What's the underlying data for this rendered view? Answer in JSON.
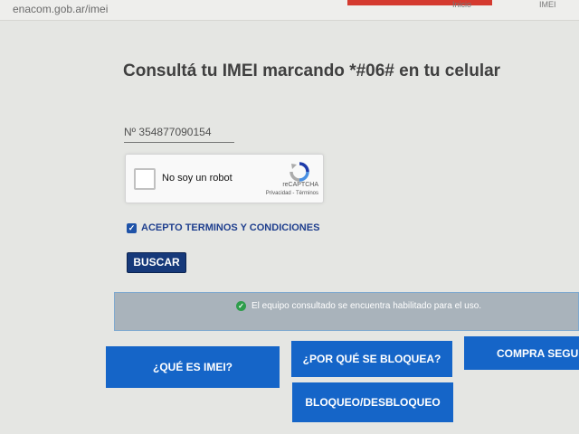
{
  "browser": {
    "url": "enacom.gob.ar/imei",
    "tabs": [
      "Inicio",
      "IMEI"
    ]
  },
  "page": {
    "title": "Consultá tu IMEI marcando *#06# en tu celular"
  },
  "imei_form": {
    "prefix": "Nº",
    "value": "354877090154",
    "recaptcha": {
      "label": "No soy un robot",
      "brand": "reCAPTCHA",
      "links": "Privacidad - Términos"
    },
    "terms_label": "ACEPTO TERMINOS Y CONDICIONES",
    "search_label": "BUSCAR"
  },
  "status": {
    "message": "El equipo consultado se encuentra habilitado para el uso."
  },
  "nav_buttons": {
    "que_es_imei": "¿QUÉ ES IMEI?",
    "por_que_bloquea": "¿POR QUÉ SE BLOQUEA?",
    "compra_segura": "COMPRA SEGURA",
    "bloqueo_desbloqueo": "BLOQUEO/DESBLOQUEO"
  },
  "colors": {
    "primary_blue": "#1565c8",
    "dark_blue": "#16397a",
    "success_green": "#2e9d4b",
    "status_gray": "#a9b3bb",
    "tab_accent": "#d43a2f"
  },
  "icons": [
    "recaptcha-logo-icon",
    "checkmark-icon",
    "success-check-icon"
  ]
}
